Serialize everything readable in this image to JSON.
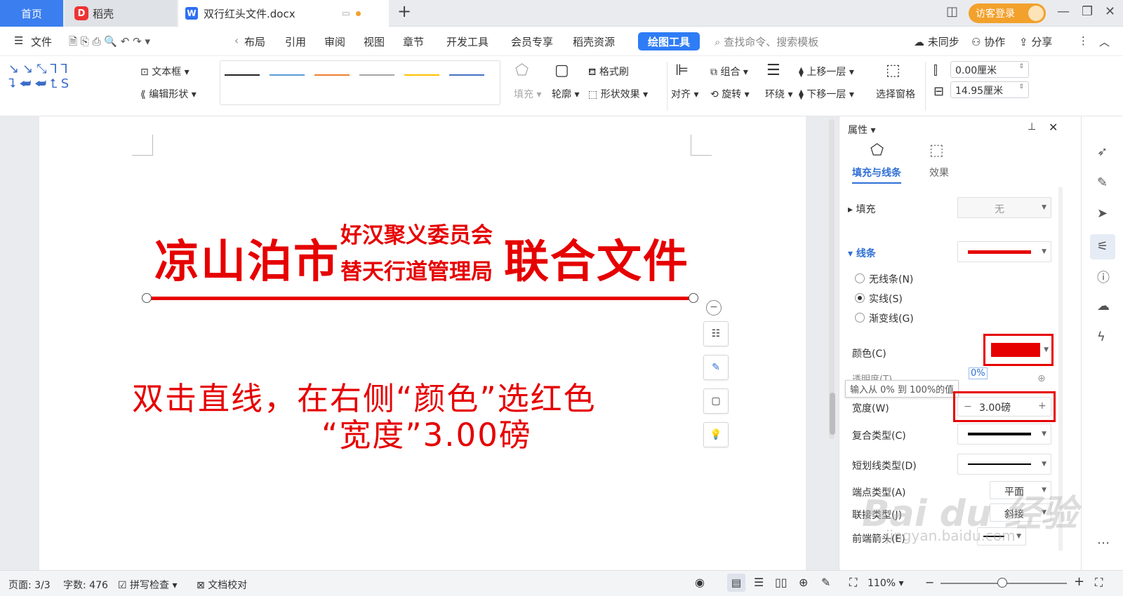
{
  "tabs": {
    "home": "首页",
    "daoke": "稻壳",
    "doc": "双行红头文件.docx",
    "visitor": "访客登录"
  },
  "menu": [
    "文件",
    "布局",
    "引用",
    "审阅",
    "视图",
    "章节",
    "开发工具",
    "会员专享",
    "稻壳资源"
  ],
  "menu_active": "绘图工具",
  "menu_right": {
    "search": "查找命令、搜索模板",
    "sync": "未同步",
    "collab": "协作",
    "share": "分享"
  },
  "ribbon": {
    "textbox": "文本框",
    "edit_shape": "编辑形状",
    "fill": "填充",
    "outline": "轮廓",
    "format_brush": "格式刷",
    "shape_effect": "形状效果",
    "align": "对齐",
    "group": "组合",
    "rotate": "旋转",
    "wrap": "环绕",
    "bring_forward": "上移一层",
    "send_backward": "下移一层",
    "select_pane": "选择窗格",
    "height": "0.00厘米",
    "width": "14.95厘米"
  },
  "gallery_colors": [
    "#222222",
    "#5b9bd5",
    "#ed7d31",
    "#a5a5a5",
    "#ffc000",
    "#4472c4"
  ],
  "document": {
    "hdr_left": "凉山泊市",
    "hdr_top": "好汉聚义委员会",
    "hdr_bottom": "替天行道管理局",
    "hdr_right": "联合文件",
    "note1": "双击直线，在右侧“颜色”选红色",
    "note2": "“宽度”3.00磅"
  },
  "panel": {
    "title": "属性",
    "tab_fill": "填充与线条",
    "tab_effect": "效果",
    "fill": "填充",
    "fill_value": "无",
    "line": "线条",
    "no_line": "无线条(N)",
    "solid": "实线(S)",
    "gradient": "渐变线(G)",
    "color": "颜色(C)",
    "transparency": "透明度(T)",
    "transparency_value": "0%",
    "tooltip": "输入从 0% 到 100%的值",
    "width": "宽度(W)",
    "width_value": "3.00磅",
    "compound": "复合类型(C)",
    "dash": "短划线类型(D)",
    "cap": "端点类型(A)",
    "cap_value": "平面",
    "join": "联接类型(J)",
    "join_value": "斜接",
    "arrow": "前端箭头(E)",
    "accent": "#e60000"
  },
  "status": {
    "page": "页面: 3/3",
    "words": "字数: 476",
    "spell": "拼写检查",
    "proof": "文档校对",
    "zoom": "110%"
  },
  "watermark": {
    "main": "Bai du 经验",
    "sub": "jingyan.baidu.com"
  }
}
